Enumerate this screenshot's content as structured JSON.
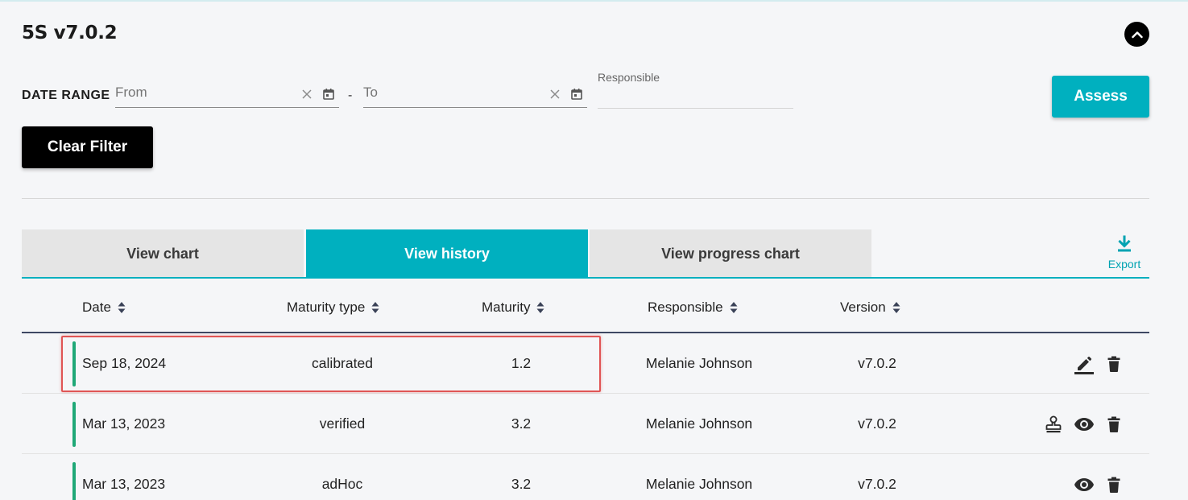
{
  "header": {
    "title": "5S v7.0.2"
  },
  "filters": {
    "date_range_label": "DATE RANGE",
    "from_placeholder": "From",
    "separator": "-",
    "to_placeholder": "To",
    "responsible_label": "Responsible",
    "responsible_value": ""
  },
  "buttons": {
    "assess": "Assess",
    "clear_filter": "Clear Filter"
  },
  "tabs": [
    {
      "label": "View chart",
      "active": false
    },
    {
      "label": "View history",
      "active": true
    },
    {
      "label": "View progress chart",
      "active": false
    }
  ],
  "export": {
    "label": "Export"
  },
  "table": {
    "columns": [
      "Date",
      "Maturity type",
      "Maturity",
      "Responsible",
      "Version"
    ],
    "rows": [
      {
        "date": "Sep 18, 2024",
        "maturity_type": "calibrated",
        "maturity": "1.2",
        "responsible": "Melanie Johnson",
        "version": "v7.0.2",
        "actions": [
          "edit-icon",
          "delete-icon"
        ]
      },
      {
        "date": "Mar 13, 2023",
        "maturity_type": "verified",
        "maturity": "3.2",
        "responsible": "Melanie Johnson",
        "version": "v7.0.2",
        "actions": [
          "stamp-icon",
          "view-icon",
          "delete-icon"
        ]
      },
      {
        "date": "Mar 13, 2023",
        "maturity_type": "adHoc",
        "maturity": "3.2",
        "responsible": "Melanie Johnson",
        "version": "v7.0.2",
        "actions": [
          "view-icon",
          "delete-icon"
        ]
      }
    ]
  },
  "colors": {
    "accent": "#00b0bf",
    "status_green": "#1fa877",
    "highlight_red": "#e05555",
    "header_line": "#3e4863"
  }
}
